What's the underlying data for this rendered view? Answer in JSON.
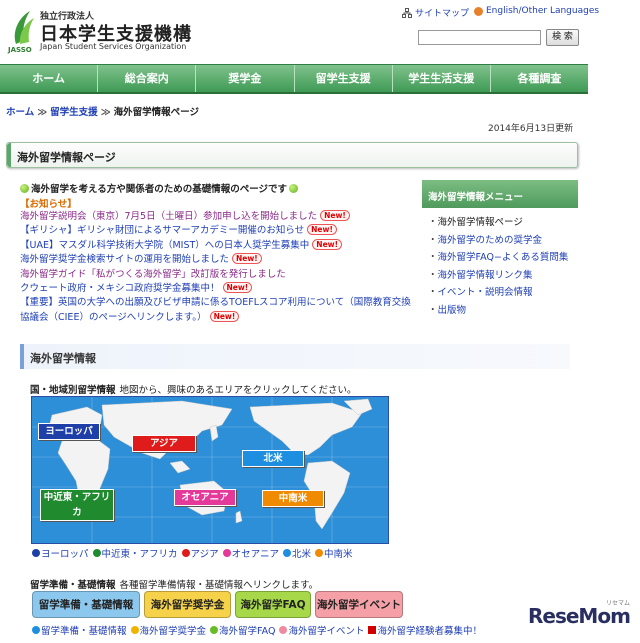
{
  "header": {
    "org_small": "独立行政法人",
    "org_name": "日本学生支援機構",
    "org_en": "Japan Student Services Organization",
    "logo_text": "JASSO",
    "sitemap": "サイトマップ",
    "lang": "English/Other Languages",
    "search_button": "検 索",
    "search_value": ""
  },
  "nav": [
    "ホーム",
    "総合案内",
    "奨学金",
    "留学生支援",
    "学生生活支援",
    "各種調査"
  ],
  "breadcrumb": {
    "home": "ホーム",
    "sep": "≫",
    "parent": "留学生支援",
    "current": "海外留学情報ページ"
  },
  "updated": "2014年6月13日更新",
  "page_title": "海外留学情報ページ",
  "intro": "海外留学を考える方や関係者のための基礎情報のページです",
  "notice_heading": "【お知らせ】",
  "new_label": "New!",
  "news": [
    {
      "text": "海外留学説明会（東京）7月5日（土曜日）参加申し込を開始しました",
      "new": true,
      "visited": true
    },
    {
      "text": "【ギリシャ】ギリシャ財団によるサマーアカデミー開催のお知らせ",
      "new": true,
      "visited": false
    },
    {
      "text": "【UAE】マスダル科学技術大学院（MIST）への日本人奨学生募集中",
      "new": true,
      "visited": false
    },
    {
      "text": "海外留学奨学金検索サイトの運用を開始しました",
      "new": true,
      "visited": false
    },
    {
      "text": "海外留学ガイド「私がつくる海外留学」改訂版を発行しました",
      "new": false,
      "visited": true
    },
    {
      "text": "クウェート政府・メキシコ政府奨学金募集中！",
      "new": true,
      "visited": false
    },
    {
      "text": "【重要】英国の大学への出願及びビザ申請に係るTOEFLスコア利用について（国際教育交換",
      "new": false,
      "visited": false
    },
    {
      "text": "協議会（CIEE）のページへリンクします。）",
      "new": true,
      "visited": false
    }
  ],
  "sidebar": {
    "heading": "海外留学情報メニュー",
    "items": [
      {
        "label": "海外留学情報ページ",
        "current": true
      },
      {
        "label": "海外留学のための奨学金",
        "current": false
      },
      {
        "label": "海外留学FAQ−よくある質問集",
        "current": false
      },
      {
        "label": "海外留学情報リンク集",
        "current": false
      },
      {
        "label": "イベント・説明会情報",
        "current": false
      },
      {
        "label": "出版物",
        "current": false
      }
    ]
  },
  "section_title": "海外留学情報",
  "map_caption": {
    "bold": "国・地域別留学情報",
    "text": "地図から、興味のあるエリアをクリックしてください。"
  },
  "regions": {
    "europe": "ヨーロッパ",
    "asia": "アジア",
    "north_america": "北米",
    "middle_east_africa": "中近東・アフリカ",
    "oceania": "オセアニア",
    "latin_america": "中南米"
  },
  "region_legend": [
    {
      "label": "ヨーロッパ",
      "color": "#1e3fa8"
    },
    {
      "label": "中近東・アフリカ",
      "color": "#1f8a2e"
    },
    {
      "label": "アジア",
      "color": "#e01b1b"
    },
    {
      "label": "オセアニア",
      "color": "#e5399a"
    },
    {
      "label": "北米",
      "color": "#1e8fe0"
    },
    {
      "label": "中南米",
      "color": "#f08a00"
    }
  ],
  "prep_caption": {
    "bold": "留学準備・基礎情報",
    "text": "各種留学準備情報・基礎情報へリンクします。"
  },
  "prep_buttons": [
    {
      "label": "留学準備・基礎情報",
      "color": "#8cc8ee"
    },
    {
      "label": "海外留学奨学金",
      "color": "#f6d24a"
    },
    {
      "label": "海外留学FAQ",
      "color": "#a6d84a"
    },
    {
      "label": "海外留学イベント",
      "color": "#f4a0a6"
    }
  ],
  "prep_legend": [
    {
      "label": "留学準備・基礎情報",
      "color": "#1e8fe0",
      "shape": "dot"
    },
    {
      "label": "海外留学奨学金",
      "color": "#f0b400",
      "shape": "dot"
    },
    {
      "label": "海外留学FAQ",
      "color": "#6aba2a",
      "shape": "dot"
    },
    {
      "label": "海外留学イベント",
      "color": "#f08aa0",
      "shape": "dot"
    },
    {
      "label": "海外留学経験者募集中！",
      "color": "#d00000",
      "shape": "square"
    }
  ],
  "watermark": "ReseMom",
  "watermark_tm": "リセマム"
}
